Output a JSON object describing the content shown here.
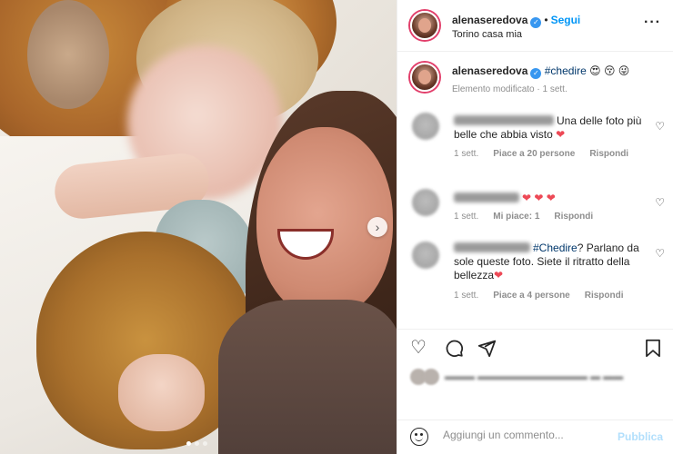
{
  "post": {
    "username": "alenaseredova",
    "follow_label": "Segui",
    "location": "Torino casa mia",
    "more_icon": "more-options-icon",
    "caption": {
      "hashtag": "#chedire",
      "emojis": "😍 😚 😜",
      "meta": "Elemento modificato · 1 sett."
    }
  },
  "comments": [
    {
      "text": "Una delle foto più belle che abbia visto ",
      "emoji": "❤",
      "time": "1 sett.",
      "likes": "Piace a 20 persone",
      "reply": "Rispondi"
    },
    {
      "text": "❤ ❤ ❤",
      "time": "1 sett.",
      "likes": "Mi piace: 1",
      "reply": "Rispondi"
    },
    {
      "hashtag": "#Chedire",
      "text": "? Parlano da sole queste foto. Siete il ritratto della bellezza",
      "emoji": "❤",
      "time": "1 sett.",
      "likes": "Piace a 4 persone",
      "reply": "Rispondi"
    }
  ],
  "actions": {
    "like_icon": "heart-icon",
    "comment_icon": "comment-icon",
    "share_icon": "send-icon",
    "save_icon": "bookmark-icon"
  },
  "composer": {
    "placeholder": "Aggiungi un commento...",
    "publish_label": "Pubblica"
  },
  "colors": {
    "link": "#0095f6",
    "hashtag": "#00376b",
    "heart": "#ed4956",
    "muted": "#8e8e8e",
    "publish_disabled": "#b2dffc"
  }
}
